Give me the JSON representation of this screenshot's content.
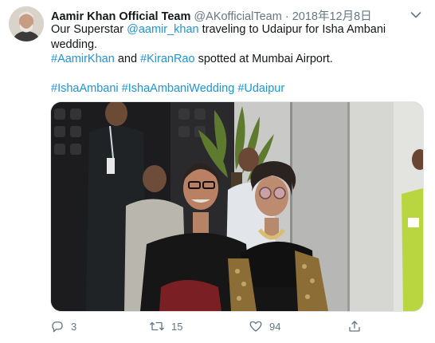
{
  "tweet": {
    "author_name": "Aamir Khan Official Team",
    "handle": "@AKofficialTeam",
    "separator": "·",
    "date": "2018年12月8日",
    "text": {
      "line1_prefix": "Our Superstar ",
      "line1_mention": "@aamir_khan",
      "line1_suffix": " traveling to Udaipur for Isha Ambani",
      "line2": "wedding.",
      "line3_tag1": "#AamirKhan",
      "line3_and": " and ",
      "line3_tag2": "#KiranRao",
      "line3_suffix": " spotted at Mumbai Airport.",
      "hashtags": [
        "#IshaAmbani",
        "#IshaAmbaniWedding",
        "#Udaipur"
      ]
    },
    "actions": {
      "replies": "3",
      "retweets": "15",
      "likes": "94"
    },
    "icons": [
      "avatar",
      "chevron-down-icon",
      "reply-icon",
      "retweet-icon",
      "like-icon",
      "share-icon"
    ],
    "colors": {
      "link": "#1b95e0",
      "secondary": "#657786",
      "text": "#14171a"
    }
  }
}
